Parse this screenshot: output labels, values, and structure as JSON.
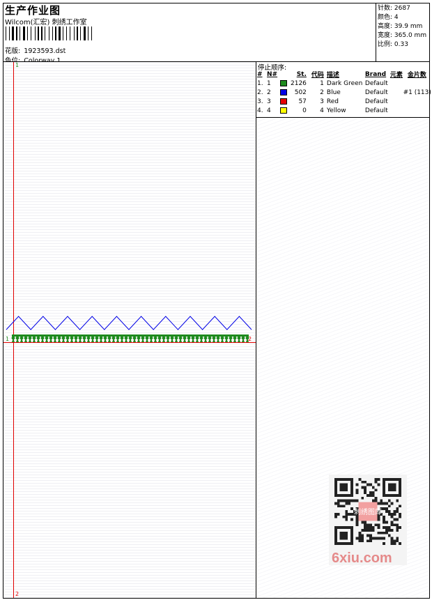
{
  "header": {
    "title": "生产作业图",
    "studio": "Wilcom(汇宏) 刺绣工作室",
    "design_label": "花版:",
    "design_file": "1923593.dst",
    "colorway_label": "色位:",
    "colorway": "Colorway 1"
  },
  "stats": [
    {
      "label": "针数:",
      "value": "2687"
    },
    {
      "label": "颜色:",
      "value": "4"
    },
    {
      "label": "高度:",
      "value": "39.9 mm"
    },
    {
      "label": "宽度:",
      "value": "365.0 mm"
    },
    {
      "label": "比例:",
      "value": "0.33"
    }
  ],
  "canvas": {
    "start_marker_top": "1",
    "start_marker_bottom": "2",
    "design_start": "1",
    "design_end": "2"
  },
  "stop_sequence": {
    "title": "停止顺序:",
    "columns": [
      "#",
      "N#",
      "St.",
      "代码",
      "描述",
      "Brand",
      "元素",
      "金片数"
    ],
    "rows": [
      {
        "idx": "1.",
        "n": "1",
        "color": "#1e8a1e",
        "st": "2126",
        "code": "1",
        "desc": "Dark Green",
        "brand": "Default",
        "elements": "",
        "sequins": ""
      },
      {
        "idx": "2.",
        "n": "2",
        "color": "#0000e6",
        "st": "502",
        "code": "2",
        "desc": "Blue",
        "brand": "Default",
        "elements": "",
        "sequins": "#1 (113)"
      },
      {
        "idx": "3.",
        "n": "3",
        "color": "#e60000",
        "st": "57",
        "code": "3",
        "desc": "Red",
        "brand": "Default",
        "elements": "",
        "sequins": ""
      },
      {
        "idx": "4.",
        "n": "4",
        "color": "#ffff00",
        "st": "0",
        "code": "4",
        "desc": "Yellow",
        "brand": "Default",
        "elements": "",
        "sequins": ""
      }
    ]
  },
  "watermark": {
    "qr_center_text": "刺绣图库",
    "site": "6xiu.com"
  }
}
